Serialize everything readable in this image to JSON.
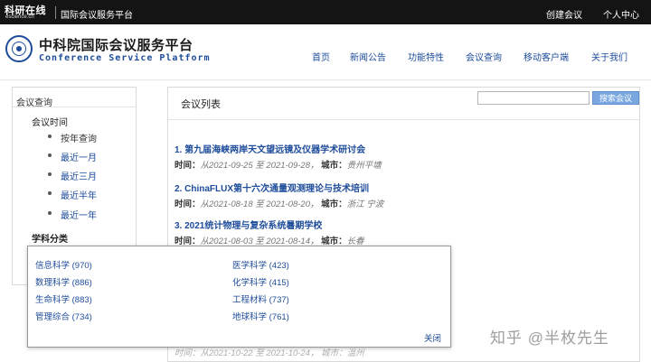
{
  "topbar": {
    "logo_cn": "科研在线",
    "logo_en": "escience.cn",
    "platform_title": "国际会议服务平台",
    "create_conference": "创建会议",
    "personal_center": "个人中心"
  },
  "header": {
    "brand_cn": "中科院国际会议服务平台",
    "brand_en": "Conference Service Platform",
    "nav": [
      "首页",
      "新闻公告",
      "功能特性",
      "会议查询",
      "移动客户端",
      "关于我们"
    ]
  },
  "sidebar": {
    "title": "会议查询",
    "time_group": "会议时间",
    "time_items": [
      "按年查询",
      "最近一月",
      "最近三月",
      "最近半年",
      "最近一年"
    ],
    "subject_group": "学科分类"
  },
  "main": {
    "title": "会议列表",
    "search_placeholder": "",
    "search_button": "搜索会议",
    "time_label": "时间：",
    "city_label": "城市：",
    "conferences": [
      {
        "title": "1. 第九届海峡两岸天文望远镜及仪器学术研讨会",
        "time": "从2021-09-25 至 2021-09-28，",
        "city": "贵州平塘"
      },
      {
        "title": "2. ChinaFLUX第十六次通量观测理论与技术培训",
        "time": "从2021-08-18 至 2021-08-20，",
        "city": "浙江 宁波"
      },
      {
        "title": "3. 2021统计物理与复杂系统暑期学校",
        "time": "从2021-08-03 至 2021-08-14，",
        "city": "长春"
      }
    ],
    "residual_text": "时间：从2021-10-22 至 2021-10-24，  城市：温州"
  },
  "popup": {
    "left_column": [
      "信息科学 (970)",
      "数理科学 (886)",
      "生命科学 (883)",
      "管理综合 (734)"
    ],
    "right_column": [
      "医学科学 (423)",
      "化学科学 (415)",
      "工程材料 (737)",
      "地球科学 (761)"
    ],
    "close": "关闭"
  },
  "watermark": "知乎 @半枚先生"
}
